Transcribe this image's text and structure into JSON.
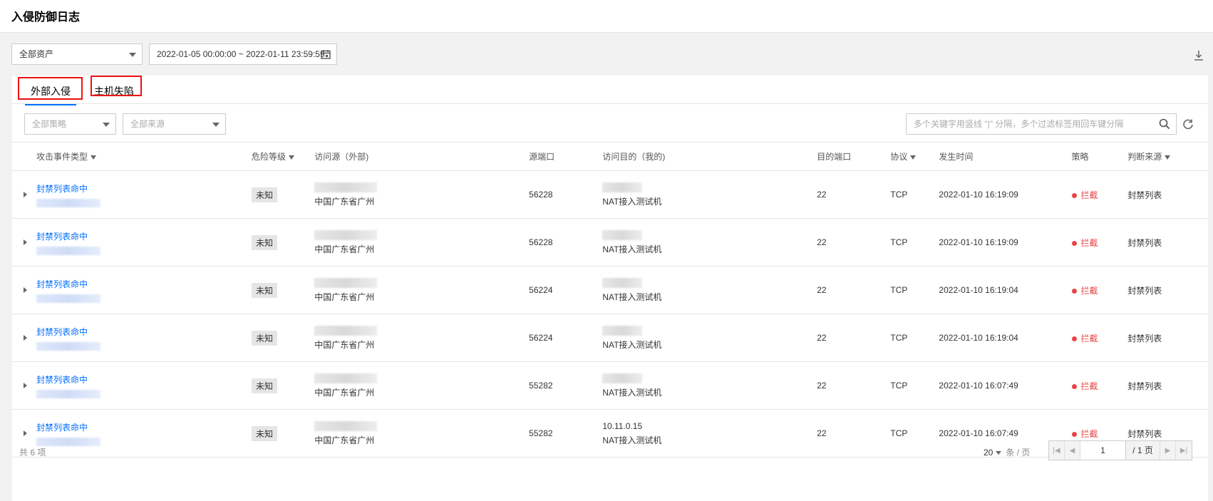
{
  "page": {
    "title": "入侵防御日志"
  },
  "toolbar": {
    "asset_select": "全部资产",
    "date_range": "2022-01-05 00:00:00 ~ 2022-01-11 23:59:59"
  },
  "tabs": [
    {
      "label": "外部入侵",
      "active": true
    },
    {
      "label": "主机失陷",
      "active": false
    }
  ],
  "filters": {
    "policy_placeholder": "全部策略",
    "source_placeholder": "全部来源",
    "search_placeholder": "多个关键字用竖线 \"|\" 分隔，多个过滤标签用回车键分隔"
  },
  "table": {
    "columns": [
      "攻击事件类型",
      "危险等级",
      "访问源（外部)",
      "源端口",
      "访问目的（我的)",
      "目的端口",
      "协议",
      "发生时间",
      "策略",
      "判断来源"
    ],
    "rows": [
      {
        "event": "封禁列表命中",
        "level": "未知",
        "source_loc": "中国广东省广州",
        "src_port": "56228",
        "dest_ip": "",
        "dest_name": "NAT接入测试机",
        "dst_port": "22",
        "protocol": "TCP",
        "time": "2022-01-10 16:19:09",
        "policy": "拦截",
        "judge": "封禁列表"
      },
      {
        "event": "封禁列表命中",
        "level": "未知",
        "source_loc": "中国广东省广州",
        "src_port": "56228",
        "dest_ip": "",
        "dest_name": "NAT接入测试机",
        "dst_port": "22",
        "protocol": "TCP",
        "time": "2022-01-10 16:19:09",
        "policy": "拦截",
        "judge": "封禁列表"
      },
      {
        "event": "封禁列表命中",
        "level": "未知",
        "source_loc": "中国广东省广州",
        "src_port": "56224",
        "dest_ip": "",
        "dest_name": "NAT接入测试机",
        "dst_port": "22",
        "protocol": "TCP",
        "time": "2022-01-10 16:19:04",
        "policy": "拦截",
        "judge": "封禁列表"
      },
      {
        "event": "封禁列表命中",
        "level": "未知",
        "source_loc": "中国广东省广州",
        "src_port": "56224",
        "dest_ip": "",
        "dest_name": "NAT接入测试机",
        "dst_port": "22",
        "protocol": "TCP",
        "time": "2022-01-10 16:19:04",
        "policy": "拦截",
        "judge": "封禁列表"
      },
      {
        "event": "封禁列表命中",
        "level": "未知",
        "source_loc": "中国广东省广州",
        "src_port": "55282",
        "dest_ip": "",
        "dest_name": "NAT接入测试机",
        "dst_port": "22",
        "protocol": "TCP",
        "time": "2022-01-10 16:07:49",
        "policy": "拦截",
        "judge": "封禁列表"
      },
      {
        "event": "封禁列表命中",
        "level": "未知",
        "source_loc": "中国广东省广州",
        "src_port": "55282",
        "dest_ip": "10.11.0.15",
        "dest_name": "NAT接入测试机",
        "dst_port": "22",
        "protocol": "TCP",
        "time": "2022-01-10 16:07:49",
        "policy": "拦截",
        "judge": "封禁列表"
      }
    ]
  },
  "footer": {
    "total": "共 6 项",
    "page_size": "20",
    "page_size_unit": "条 / 页",
    "current_page": "1",
    "total_pages": "/ 1 页"
  },
  "colors": {
    "accent": "#006eff",
    "danger": "#e54545",
    "highlight": "#e11111"
  },
  "icons": [
    "calendar-icon",
    "download-icon",
    "search-icon",
    "refresh-icon",
    "filter-icon",
    "expand-icon",
    "first-page-icon",
    "prev-page-icon",
    "next-page-icon",
    "last-page-icon"
  ]
}
